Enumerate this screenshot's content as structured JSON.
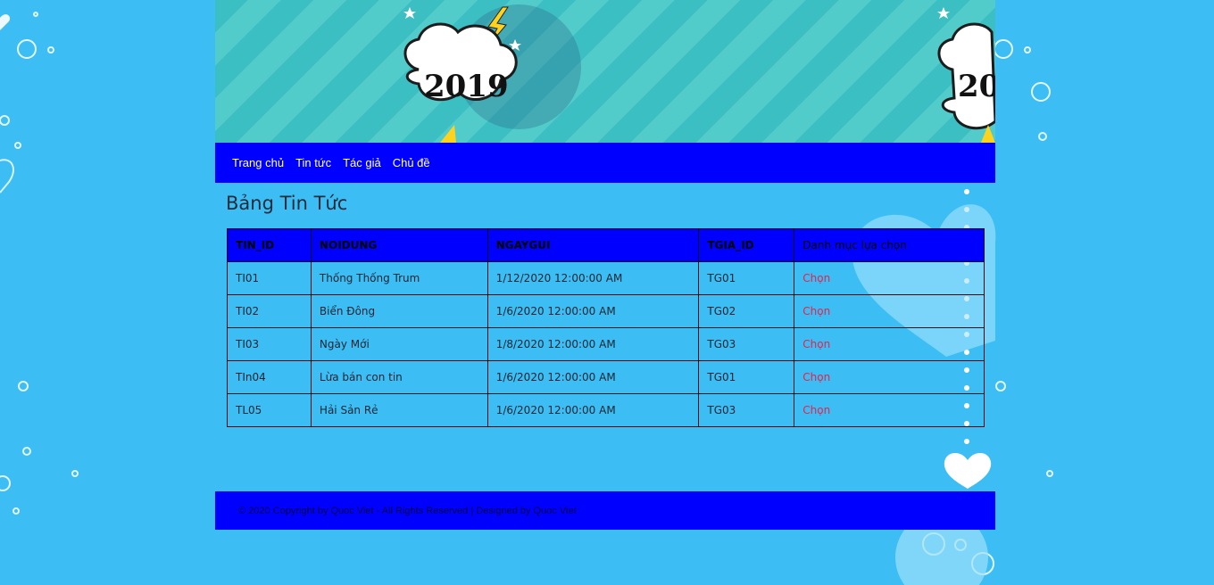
{
  "nav": {
    "items": [
      "Trang chủ",
      "Tin tức",
      "Tác giả",
      "Chủ đề"
    ]
  },
  "banner": {
    "year_text": "2019",
    "partial_text": "20"
  },
  "page_title": "Bảng Tin Tức",
  "table": {
    "headers": [
      "TIN_ID",
      "NOIDUNG",
      "NGAYGUI",
      "TGIA_ID",
      "Danh mục lựa chọn"
    ],
    "rows": [
      {
        "id": "TI01",
        "content": "Thống Thống Trum",
        "date": "1/12/2020 12:00:00 AM",
        "author": "TG01",
        "action": "Chọn"
      },
      {
        "id": "TI02",
        "content": "Biển Đông",
        "date": "1/6/2020 12:00:00 AM",
        "author": "TG02",
        "action": "Chọn"
      },
      {
        "id": "TI03",
        "content": "Ngày Mới",
        "date": "1/8/2020 12:00:00 AM",
        "author": "TG03",
        "action": "Chọn"
      },
      {
        "id": "TIn04",
        "content": "Lừa bán con tin",
        "date": "1/6/2020 12:00:00 AM",
        "author": "TG01",
        "action": "Chọn"
      },
      {
        "id": "TL05",
        "content": "Hải Sản Rẻ",
        "date": "1/6/2020 12:00:00 AM",
        "author": "TG03",
        "action": "Chọn"
      }
    ]
  },
  "footer": {
    "text": "© 2020 Copyright by Quoc Viet - All Rights Reserved | Designed by Quoc Viet"
  },
  "colors": {
    "background": "#3cbef5",
    "nav_bg": "#0000ff",
    "link_action": "#e8224a"
  }
}
